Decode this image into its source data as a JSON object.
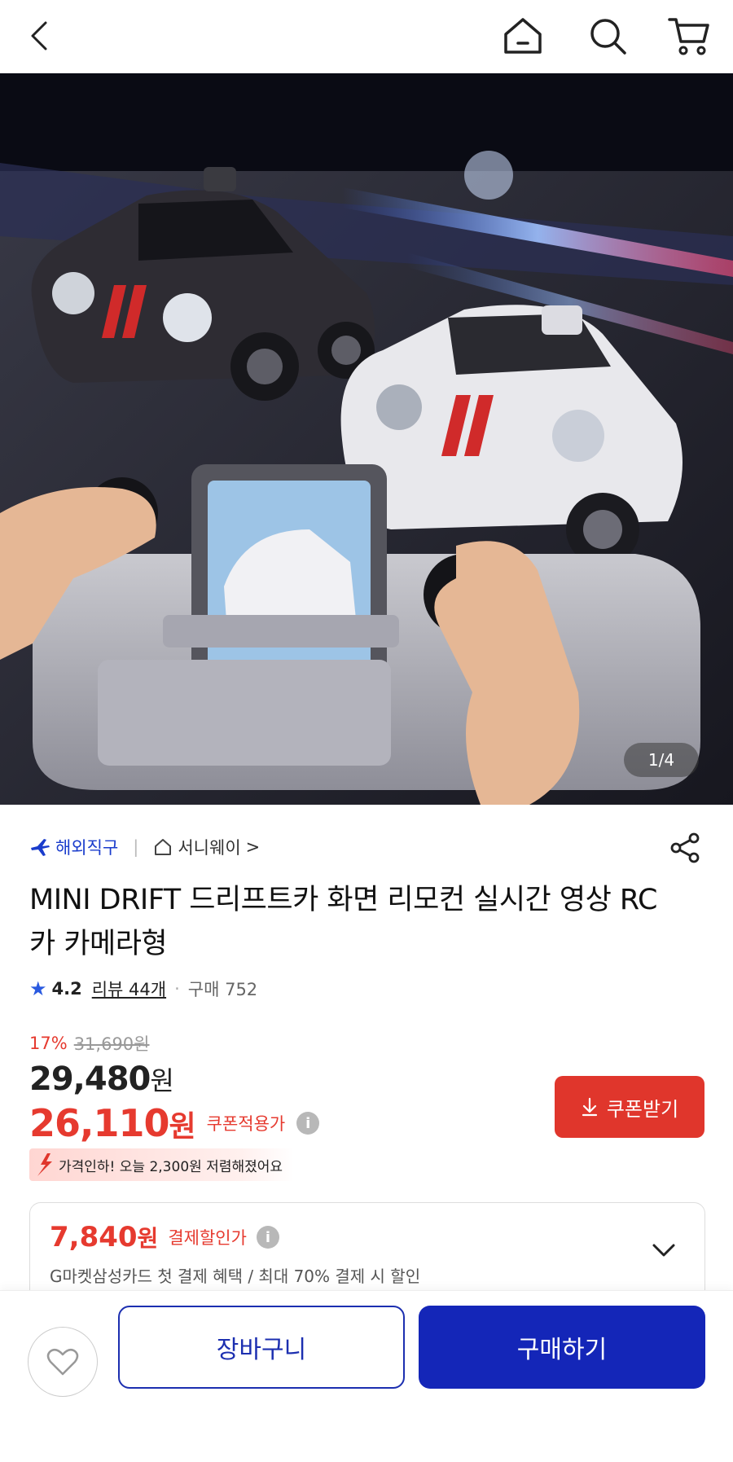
{
  "topbar": {
    "back_icon": "chevron-left-icon",
    "home_icon": "home-icon",
    "search_icon": "search-icon",
    "cart_icon": "cart-icon"
  },
  "gallery": {
    "counter": "1/4"
  },
  "seller": {
    "overseas_label": "해외직구",
    "shop_name": "서니웨이",
    "shop_arrow": ">"
  },
  "product": {
    "title": "MINI DRIFT 드리프트카 화면 리모컨 실시간 영상 RC카 카메라형",
    "rating": "4.2",
    "reviews": "리뷰 44개",
    "separator": "·",
    "purchases": "구매 752"
  },
  "pricing": {
    "discount_rate": "17%",
    "original_price": "31,690원",
    "price_number": "29,480",
    "price_unit": "원",
    "coupon_price_number": "26,110",
    "coupon_price_unit": "원",
    "coupon_price_label": "쿠폰적용가",
    "info_glyph": "i",
    "coupon_button": "쿠폰받기",
    "price_drop_text": "가격인하! 오늘 2,300원 저렴해졌어요"
  },
  "payment": {
    "amount_number": "7,840",
    "amount_unit": "원",
    "label": "결제할인가",
    "description": "G마켓삼성카드 첫 결제 혜택 / 최대 70% 결제 시 할인"
  },
  "actions": {
    "wishlist_icon": "heart-icon",
    "cart_label": "장바구니",
    "buy_label": "구매하기"
  },
  "colors": {
    "accent_red": "#e0362c",
    "brand_blue": "#1426b8"
  }
}
